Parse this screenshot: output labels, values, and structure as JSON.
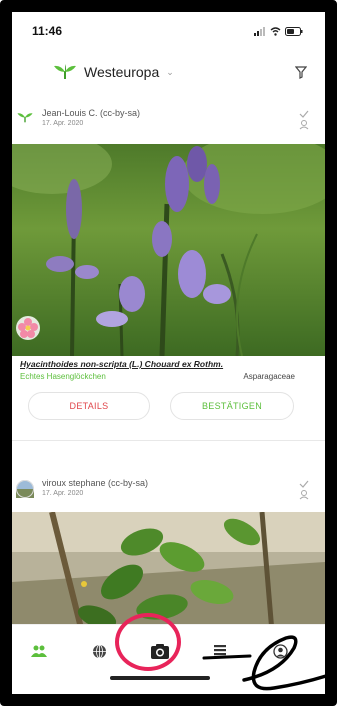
{
  "status": {
    "time": "11:46"
  },
  "header": {
    "title": "Westeuropa",
    "logo_icon": "plant-logo-icon",
    "filter_icon": "filter-icon"
  },
  "observations": [
    {
      "author": "Jean-Louis C. (cc-by-sa)",
      "date": "17. Apr. 2020",
      "scientific_name": "Hyacinthoides non-scripta (L.) Chouard ex Rothm.",
      "common_name": "Echtes Hasenglöckchen",
      "family": "Asparagaceae",
      "details_label": "DETAILS",
      "confirm_label": "BESTÄTIGEN"
    },
    {
      "author": "viroux stephane (cc-by-sa)",
      "date": "17. Apr. 2020"
    }
  ],
  "tabs": [
    {
      "icon": "community-icon",
      "active": true
    },
    {
      "icon": "globe-icon",
      "active": false
    },
    {
      "icon": "camera-icon",
      "active": false
    },
    {
      "icon": "list-icon",
      "active": false
    },
    {
      "icon": "profile-icon",
      "active": false
    }
  ],
  "colors": {
    "accent_green": "#5cbf3c",
    "details_red": "#e0464b",
    "annotation": "#e8245a"
  }
}
